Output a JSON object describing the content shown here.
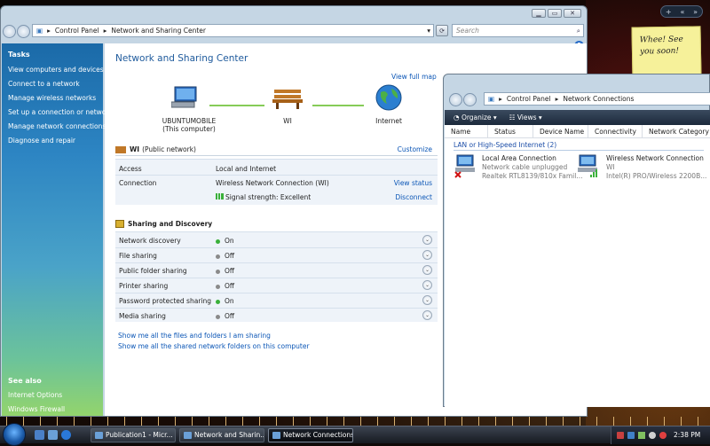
{
  "desktop": {
    "gadget_add": "+",
    "gadget_prev": "«",
    "gadget_next": "»",
    "note_text": "Whee!  See you soon!"
  },
  "main_window": {
    "breadcrumb": [
      "Control Panel",
      "Network and Sharing Center"
    ],
    "search_placeholder": "Search",
    "tasks_header": "Tasks",
    "tasks": [
      "View computers and devices",
      "Connect to a network",
      "Manage wireless networks",
      "Set up a connection or network",
      "Manage network connections",
      "Diagnose and repair"
    ],
    "see_also_header": "See also",
    "see_also": [
      "Internet Options",
      "Windows Firewall"
    ],
    "title": "Network and Sharing Center",
    "view_full_map": "View full map",
    "computer_name": "UBUNTUMOBILE",
    "computer_sub": "(This computer)",
    "network_node": "WI",
    "internet_node": "Internet",
    "network_name": "WI",
    "network_type": "(Public network)",
    "customize": "Customize",
    "access_label": "Access",
    "access_value": "Local and Internet",
    "connection_label": "Connection",
    "connection_value": "Wireless Network Connection (WI)",
    "view_status": "View status",
    "signal": "Signal strength:  Excellent",
    "disconnect": "Disconnect",
    "sharing_header": "Sharing and Discovery",
    "sharing": [
      {
        "label": "Network discovery",
        "state": "On",
        "color": "#3ab03a"
      },
      {
        "label": "File sharing",
        "state": "Off",
        "color": "#8a8a8a"
      },
      {
        "label": "Public folder sharing",
        "state": "Off",
        "color": "#8a8a8a"
      },
      {
        "label": "Printer sharing",
        "state": "Off",
        "color": "#8a8a8a"
      },
      {
        "label": "Password protected sharing",
        "state": "On",
        "color": "#3ab03a"
      },
      {
        "label": "Media sharing",
        "state": "Off",
        "color": "#8a8a8a"
      }
    ],
    "bottom_links": [
      "Show me all the files and folders I am sharing",
      "Show me all the shared network folders on this computer"
    ]
  },
  "conn_window": {
    "breadcrumb": [
      "Control Panel",
      "Network Connections"
    ],
    "organize": "Organize",
    "views": "Views",
    "columns": [
      "Name",
      "Status",
      "Device Name",
      "Connectivity",
      "Network Category"
    ],
    "group": "LAN or High-Speed Internet (2)",
    "items": [
      {
        "name": "Local Area Connection",
        "status": "Network cable unplugged",
        "device": "Realtek RTL8139/810x Famil..."
      },
      {
        "name": "Wireless Network Connection",
        "status": "WI",
        "device": "Intel(R) PRO/Wireless 2200B..."
      }
    ]
  },
  "taskbar": {
    "buttons": [
      "Publication1 - Micr...",
      "Network and Sharin...",
      "Network Connections"
    ],
    "clock": "2:38 PM"
  }
}
